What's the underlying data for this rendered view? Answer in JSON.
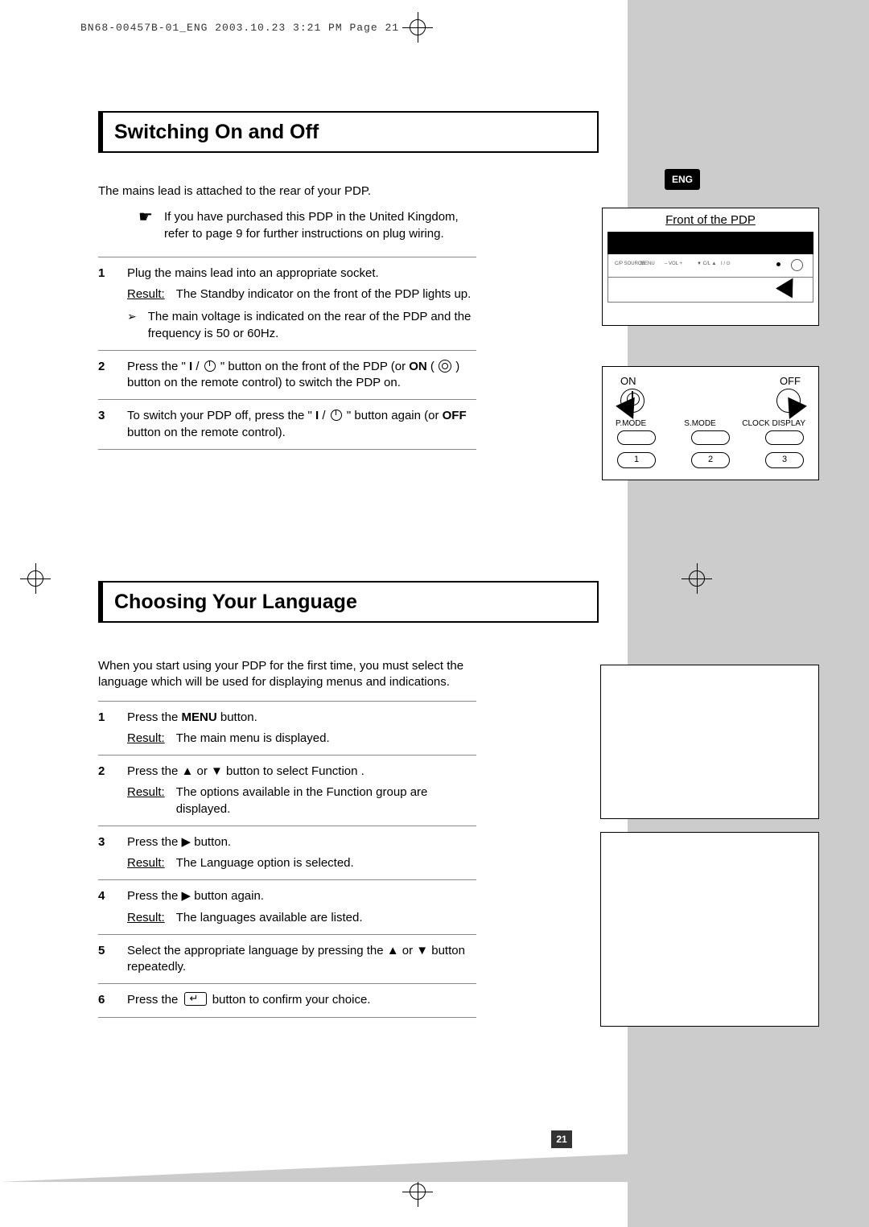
{
  "header": "BN68-00457B-01_ENG  2003.10.23  3:21 PM  Page 21",
  "eng_tab": "ENG",
  "page_number": "21",
  "section1": {
    "title": "Switching On and Off",
    "intro": "The mains lead is attached to the rear of your PDP.",
    "tip": "If you have purchased this PDP in the United Kingdom, refer to page 9 for further instructions on plug wiring.",
    "steps": [
      {
        "n": "1",
        "text": "Plug the mains lead into an appropriate socket.",
        "result": "The Standby indicator on the front of the PDP lights up.",
        "subnote": "The main voltage is indicated on the rear of the PDP and the frequency is 50 or 60Hz."
      },
      {
        "n": "2",
        "text_a": "Press the \" ",
        "text_b": "I",
        "text_c": " / ",
        "text_d": " \" button on the front of the PDP (or ",
        "text_e": "ON",
        "text_f": " ( ",
        "text_g": " ) button on the remote control) to switch the PDP on."
      },
      {
        "n": "3",
        "text_a": "To switch your PDP off, press the \" ",
        "text_b": "I",
        "text_c": " / ",
        "text_d": " \" button again (or ",
        "text_e": "OFF",
        "text_f": " button on the remote control)."
      }
    ],
    "front_caption": "Front of the PDP",
    "panel_labels": {
      "a": "C/P\nSOURCE",
      "b": "MENU",
      "c": "–  VOL  +",
      "d": "▼  C/L  ▲",
      "e": "I / ⏻"
    },
    "remote": {
      "on": "ON",
      "off": "OFF",
      "pmode": "P.MODE",
      "smode": "S.MODE",
      "clock": "CLOCK DISPLAY",
      "b1": "1",
      "b2": "2",
      "b3": "3"
    }
  },
  "section2": {
    "title": "Choosing Your Language",
    "intro": "When you start using your PDP for the first time, you must select the language which will be used for displaying menus and indications.",
    "steps": [
      {
        "n": "1",
        "text_a": "Press the ",
        "text_b": "MENU",
        "text_c": " button.",
        "result": "The main menu is displayed."
      },
      {
        "n": "2",
        "text": "Press the ▲ or ▼ button to select Function   .",
        "result": "The options available in the Function   group are displayed."
      },
      {
        "n": "3",
        "text": "Press the ▶ button.",
        "result": "The Language  option is selected."
      },
      {
        "n": "4",
        "text": "Press the ▶ button again.",
        "result": "The languages available are listed."
      },
      {
        "n": "5",
        "text": "Select the appropriate language by pressing the ▲ or ▼ button repeatedly."
      },
      {
        "n": "6",
        "text_a": "Press the ",
        "text_b": " button to confirm your choice."
      }
    ]
  },
  "result_label": "Result:"
}
